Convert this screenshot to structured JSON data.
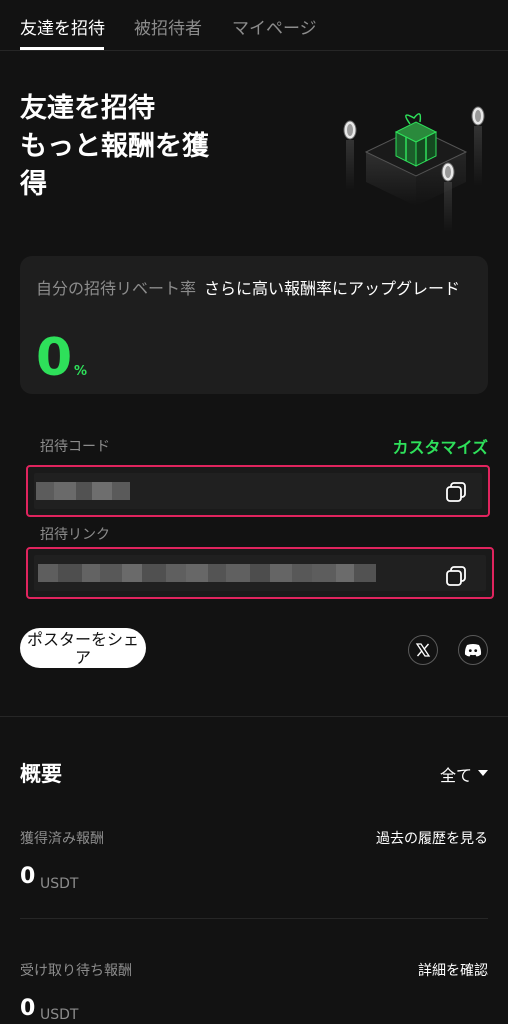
{
  "tabs": [
    {
      "label": "友達を招待"
    },
    {
      "label": "被招待者"
    },
    {
      "label": "マイページ"
    }
  ],
  "hero": {
    "title_line1": "友達を招待",
    "title_line2": "もっと報酬を獲",
    "title_line3": "得"
  },
  "rebate": {
    "label": "自分の招待リベート率",
    "upgrade_text": "さらに高い報酬率にアップグレード",
    "value": "0",
    "unit": "%"
  },
  "invite_code": {
    "label": "招待コード",
    "customize_label": "カスタマイズ"
  },
  "invite_link": {
    "label": "招待リンク"
  },
  "share": {
    "poster_button_label": "ポスターをシェア"
  },
  "overview": {
    "title": "概要",
    "filter_value": "全て",
    "earned": {
      "label": "獲得済み報酬",
      "link": "過去の履歴を見る",
      "value": "0",
      "unit": "USDT"
    },
    "pending": {
      "label": "受け取り待ち報酬",
      "link": "詳細を確認",
      "value": "0",
      "unit": "USDT"
    }
  },
  "colors": {
    "background": "#121212",
    "accent_green": "#2ee05a",
    "highlight_border": "#e0245e",
    "muted_text": "#8c8c8c"
  },
  "icons": [
    "copy-icon",
    "x-twitter-icon",
    "discord-icon",
    "gift-box-icon",
    "chevron-down-icon"
  ]
}
